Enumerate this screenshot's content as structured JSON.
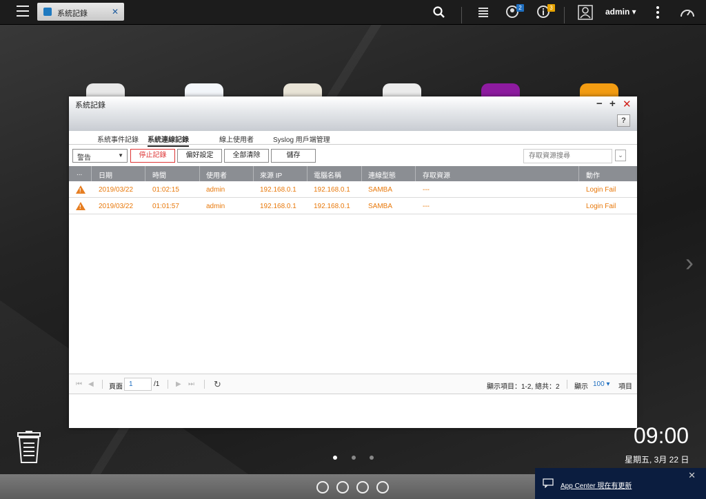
{
  "taskbar": {
    "app_tab": "系統記錄",
    "tab_close": "✕",
    "notifications": {
      "background_tasks_badge": "2",
      "info_badge": "3"
    },
    "user": "admin ▾"
  },
  "window": {
    "title": "系統記錄",
    "controls": {
      "minimize": "−",
      "maximize": "+",
      "close": "✕"
    },
    "help": "?",
    "tabs": [
      "系統事件記錄",
      "系統連線記錄",
      "線上使用者",
      "Syslog 用戶端管理"
    ],
    "active_tab": "系統連線記錄",
    "toolbar": {
      "filter_select": "警告",
      "stop_logging": "停止記錄",
      "preferences": "偏好設定",
      "clear_all": "全部清除",
      "save": "儲存",
      "search_placeholder": "存取資源搜尋",
      "search_toggle": "⌄"
    },
    "table": {
      "columns": [
        "...",
        "日期",
        "時間",
        "使用者",
        "來源 IP",
        "電腦名稱",
        "連線型態",
        "存取資源",
        "動作"
      ],
      "rows": [
        {
          "date": "2019/03/22",
          "time": "01:02:15",
          "user": "admin",
          "source_ip": "192.168.0.1",
          "computer": "192.168.0.1",
          "type": "SAMBA",
          "resource": "---",
          "action": "Login Fail"
        },
        {
          "date": "2019/03/22",
          "time": "01:01:57",
          "user": "admin",
          "source_ip": "192.168.0.1",
          "computer": "192.168.0.1",
          "type": "SAMBA",
          "resource": "---",
          "action": "Login Fail"
        }
      ]
    },
    "pager": {
      "page_label": "頁面",
      "page_value": "1",
      "total_pages": "/1",
      "summary": "顯示項目：1-2, 總共：2",
      "show_label": "顯示",
      "page_size": "100",
      "items_label": "項目"
    }
  },
  "desktop": {
    "time": "09:00",
    "date": "星期五, 3月 22 日",
    "notification": "App Center 現在有更新",
    "notification_close": "✕"
  },
  "colors": {
    "warning": "#e67e22",
    "accent": "#1f6fc0",
    "stop_red": "#d33333"
  }
}
